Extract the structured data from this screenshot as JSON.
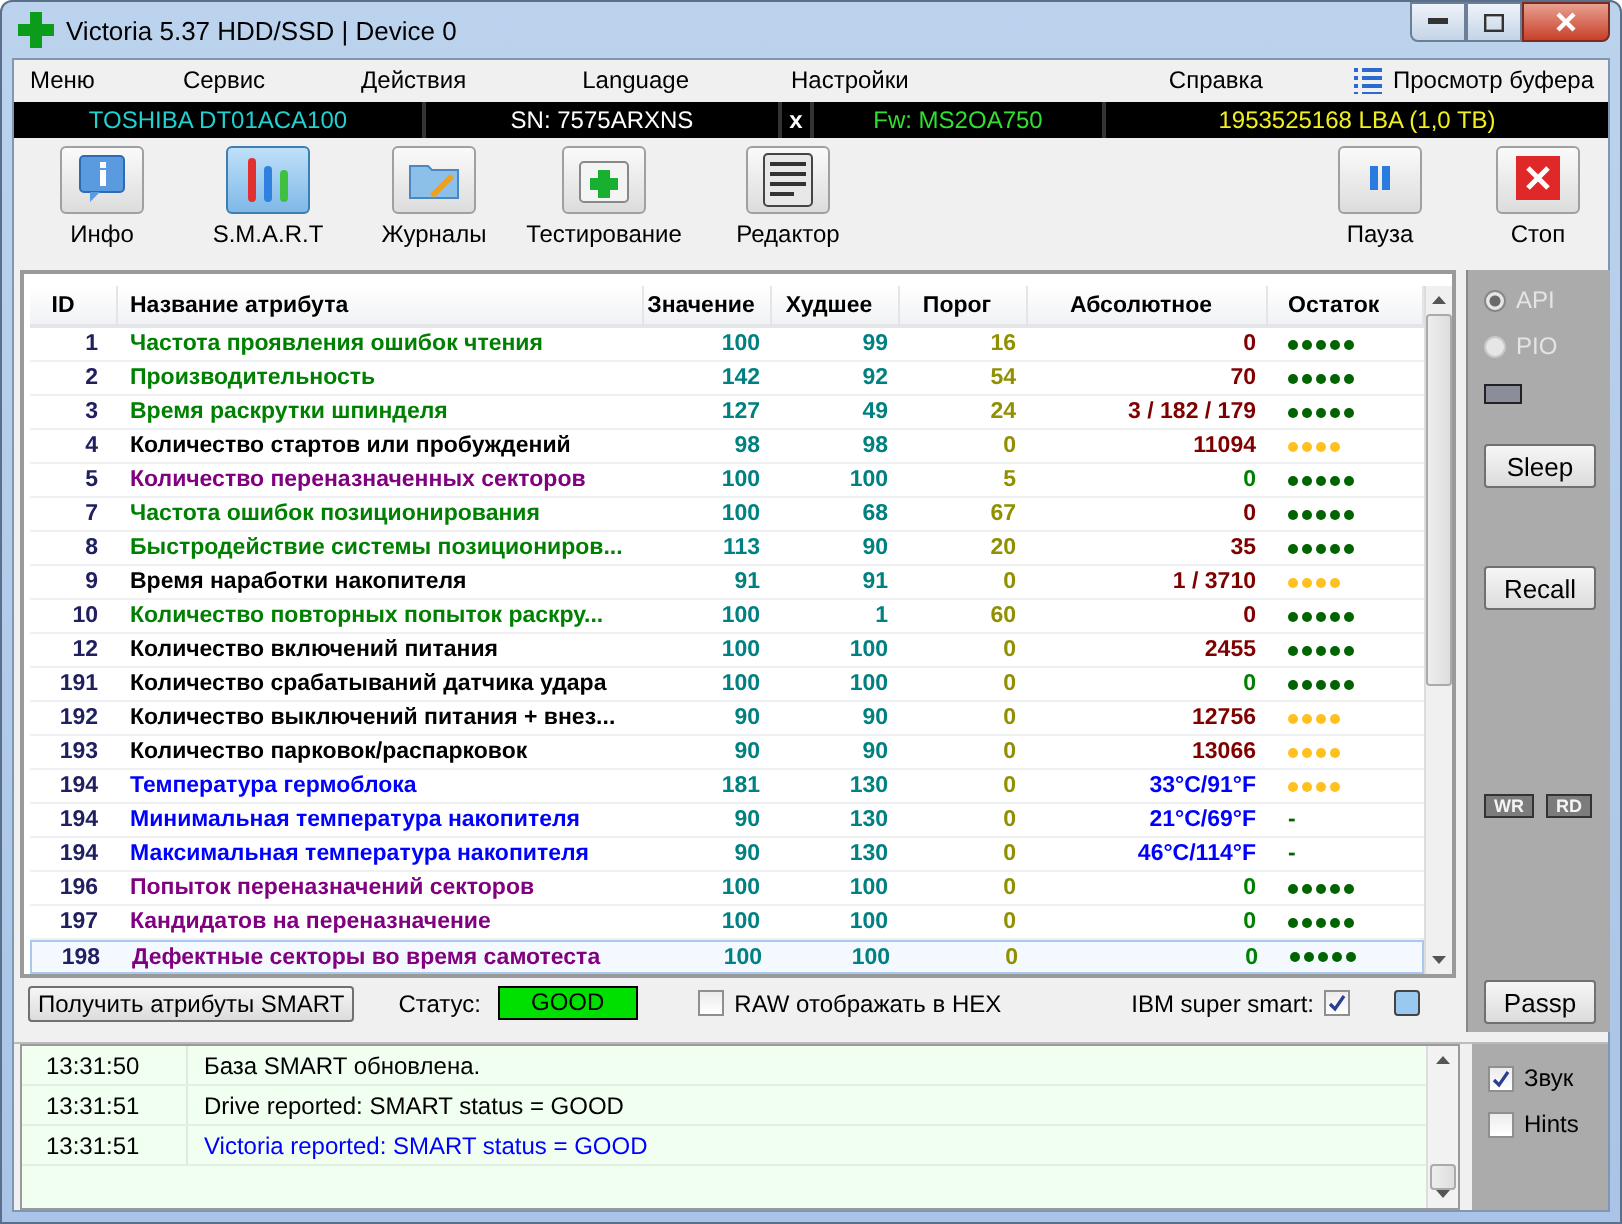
{
  "window": {
    "title": "Victoria 5.37 HDD/SSD | Device 0"
  },
  "menu": [
    {
      "label": "Меню"
    },
    {
      "label": "Сервис"
    },
    {
      "label": "Действия"
    },
    {
      "label": "Language"
    },
    {
      "label": "Настройки"
    },
    {
      "label": "Справка"
    }
  ],
  "buffer_view": {
    "label": "Просмотр буфера"
  },
  "drive": {
    "model": "TOSHIBA DT01ACA100",
    "serial": "SN: 7575ARXNS",
    "close": "x",
    "firmware": "Fw: MS2OA750",
    "capacity": "1953525168 LBA (1,0 TB)"
  },
  "toolbar": [
    {
      "label": "Инфо",
      "kind": "info",
      "selected": false
    },
    {
      "label": "S.M.A.R.T",
      "kind": "smart",
      "selected": true
    },
    {
      "label": "Журналы",
      "kind": "logs",
      "selected": false
    },
    {
      "label": "Тестирование",
      "kind": "test",
      "selected": false
    },
    {
      "label": "Редактор",
      "kind": "editor",
      "selected": false
    }
  ],
  "controls": [
    {
      "label": "Пауза",
      "kind": "pause"
    },
    {
      "label": "Стоп",
      "kind": "stop"
    }
  ],
  "table": {
    "columns": [
      "ID",
      "Название атрибута",
      "Значение",
      "Худшее",
      "Порог",
      "Абсолютное",
      "Остаток"
    ],
    "rows": [
      {
        "id": "1",
        "name": "Частота проявления ошибок чтения",
        "color": "#008000",
        "value": "100",
        "worst": "99",
        "threshold": "16",
        "raw": {
          "text": "0",
          "color": "#800000"
        },
        "remainder": {
          "kind": "dots",
          "stars": 5,
          "color": "#006400"
        },
        "selected": false
      },
      {
        "id": "2",
        "name": "Производительность",
        "color": "#008000",
        "value": "142",
        "worst": "92",
        "threshold": "54",
        "raw": {
          "text": "70",
          "color": "#800000"
        },
        "remainder": {
          "kind": "dots",
          "stars": 5,
          "color": "#006400"
        },
        "selected": false
      },
      {
        "id": "3",
        "name": "Время раскрутки шпинделя",
        "color": "#008000",
        "value": "127",
        "worst": "49",
        "threshold": "24",
        "raw": {
          "text": "3 / 182 / 179",
          "color": "#800000"
        },
        "remainder": {
          "kind": "dots",
          "stars": 5,
          "color": "#006400"
        },
        "selected": false
      },
      {
        "id": "4",
        "name": "Количество стартов или пробуждений",
        "color": "#000000",
        "value": "98",
        "worst": "98",
        "threshold": "0",
        "raw": {
          "text": "11094",
          "color": "#800000"
        },
        "remainder": {
          "kind": "dots",
          "stars": 4,
          "color": "#ffc020"
        },
        "selected": false
      },
      {
        "id": "5",
        "name": "Количество переназначенных секторов",
        "color": "#800080",
        "value": "100",
        "worst": "100",
        "threshold": "5",
        "raw": {
          "text": "0",
          "color": "#008000"
        },
        "remainder": {
          "kind": "dots",
          "stars": 5,
          "color": "#006400"
        },
        "selected": false
      },
      {
        "id": "7",
        "name": "Частота ошибок позиционирования",
        "color": "#008000",
        "value": "100",
        "worst": "68",
        "threshold": "67",
        "raw": {
          "text": "0",
          "color": "#800000"
        },
        "remainder": {
          "kind": "dots",
          "stars": 5,
          "color": "#006400"
        },
        "selected": false
      },
      {
        "id": "8",
        "name": "Быстродействие системы позициониров...",
        "color": "#008000",
        "value": "113",
        "worst": "90",
        "threshold": "20",
        "raw": {
          "text": "35",
          "color": "#800000"
        },
        "remainder": {
          "kind": "dots",
          "stars": 5,
          "color": "#006400"
        },
        "selected": false
      },
      {
        "id": "9",
        "name": "Время наработки накопителя",
        "color": "#000000",
        "value": "91",
        "worst": "91",
        "threshold": "0",
        "raw": {
          "text": "1 / 3710",
          "color": "#800000"
        },
        "remainder": {
          "kind": "dots",
          "stars": 4,
          "color": "#ffc020"
        },
        "selected": false
      },
      {
        "id": "10",
        "name": "Количество повторных попыток раскру...",
        "color": "#008000",
        "value": "100",
        "worst": "1",
        "threshold": "60",
        "raw": {
          "text": "0",
          "color": "#800000"
        },
        "remainder": {
          "kind": "dots",
          "stars": 5,
          "color": "#006400"
        },
        "selected": false
      },
      {
        "id": "12",
        "name": "Количество включений питания",
        "color": "#000000",
        "value": "100",
        "worst": "100",
        "threshold": "0",
        "raw": {
          "text": "2455",
          "color": "#800000"
        },
        "remainder": {
          "kind": "dots",
          "stars": 5,
          "color": "#006400"
        },
        "selected": false
      },
      {
        "id": "191",
        "name": "Количество срабатываний датчика удара",
        "color": "#000000",
        "value": "100",
        "worst": "100",
        "threshold": "0",
        "raw": {
          "text": "0",
          "color": "#008000"
        },
        "remainder": {
          "kind": "dots",
          "stars": 5,
          "color": "#006400"
        },
        "selected": false
      },
      {
        "id": "192",
        "name": "Количество выключений питания + внез...",
        "color": "#000000",
        "value": "90",
        "worst": "90",
        "threshold": "0",
        "raw": {
          "text": "12756",
          "color": "#800000"
        },
        "remainder": {
          "kind": "dots",
          "stars": 4,
          "color": "#ffc020"
        },
        "selected": false
      },
      {
        "id": "193",
        "name": "Количество парковок/распарковок",
        "color": "#000000",
        "value": "90",
        "worst": "90",
        "threshold": "0",
        "raw": {
          "text": "13066",
          "color": "#800000"
        },
        "remainder": {
          "kind": "dots",
          "stars": 4,
          "color": "#ffc020"
        },
        "selected": false
      },
      {
        "id": "194",
        "name": "Температура гермоблока",
        "color": "#0000ff",
        "value": "181",
        "worst": "130",
        "threshold": "0",
        "raw": {
          "text": "33°C/91°F",
          "color": "#0000ff"
        },
        "remainder": {
          "kind": "dots",
          "stars": 4,
          "color": "#ffc020"
        },
        "selected": false
      },
      {
        "id": "194",
        "name": "Минимальная температура накопителя",
        "color": "#0000ff",
        "value": "90",
        "worst": "130",
        "threshold": "0",
        "raw": {
          "text": "21°C/69°F",
          "color": "#0000ff"
        },
        "remainder": {
          "kind": "text",
          "text": "-"
        },
        "selected": false
      },
      {
        "id": "194",
        "name": "Максимальная температура накопителя",
        "color": "#0000ff",
        "value": "90",
        "worst": "130",
        "threshold": "0",
        "raw": {
          "text": "46°C/114°F",
          "color": "#0000ff"
        },
        "remainder": {
          "kind": "text",
          "text": "-"
        },
        "selected": false
      },
      {
        "id": "196",
        "name": "Попыток переназначений секторов",
        "color": "#800080",
        "value": "100",
        "worst": "100",
        "threshold": "0",
        "raw": {
          "text": "0",
          "color": "#008000"
        },
        "remainder": {
          "kind": "dots",
          "stars": 5,
          "color": "#006400"
        },
        "selected": false
      },
      {
        "id": "197",
        "name": "Кандидатов на переназначение",
        "color": "#800080",
        "value": "100",
        "worst": "100",
        "threshold": "0",
        "raw": {
          "text": "0",
          "color": "#008000"
        },
        "remainder": {
          "kind": "dots",
          "stars": 5,
          "color": "#006400"
        },
        "selected": false
      },
      {
        "id": "198",
        "name": "Дефектные секторы во время самотеста",
        "color": "#800080",
        "value": "100",
        "worst": "100",
        "threshold": "0",
        "raw": {
          "text": "0",
          "color": "#008000"
        },
        "remainder": {
          "kind": "dots",
          "stars": 5,
          "color": "#006400"
        },
        "selected": true
      }
    ]
  },
  "side": {
    "modes": [
      {
        "label": "API",
        "selected": true
      },
      {
        "label": "PIO",
        "selected": false
      }
    ],
    "buttons": [
      "Sleep",
      "Recall"
    ],
    "indicators": [
      "WR",
      "RD"
    ],
    "passp": "Passp"
  },
  "status_bar": {
    "get_button": "Получить атрибуты SMART",
    "status_label": "Статус:",
    "status": "GOOD",
    "hex": {
      "label": "RAW отображать в HEX",
      "checked": false
    },
    "ibm": {
      "label": "IBM super smart:",
      "checked": true
    }
  },
  "log": [
    {
      "time": "13:31:50",
      "text": "База SMART обновлена.",
      "color": "#000000"
    },
    {
      "time": "13:31:51",
      "text": "Drive reported: SMART status = GOOD",
      "color": "#000000"
    },
    {
      "time": "13:31:51",
      "text": "Victoria reported: SMART status = GOOD",
      "color": "#0000ff"
    }
  ],
  "options": [
    {
      "label": "Звук",
      "checked": true
    },
    {
      "label": "Hints",
      "checked": false
    }
  ]
}
